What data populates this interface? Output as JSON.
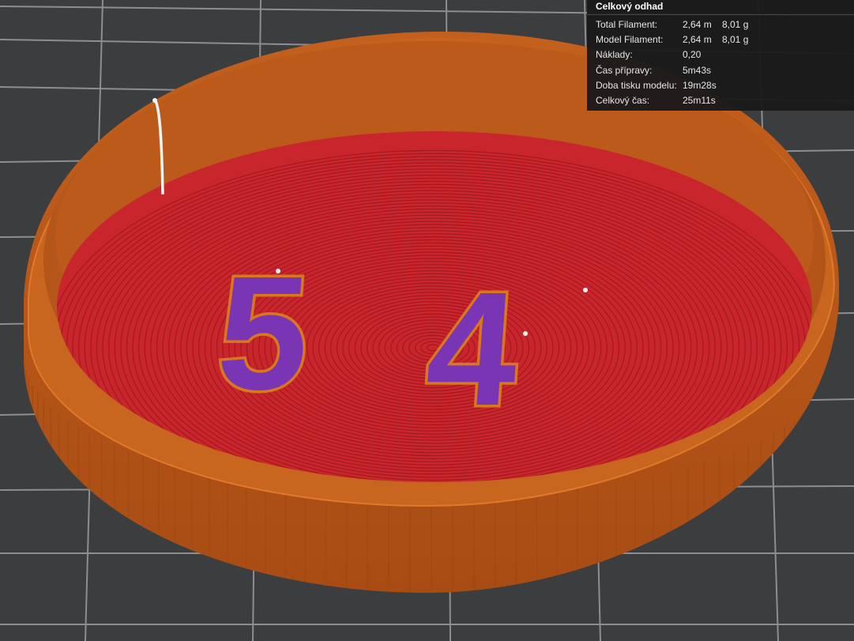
{
  "viewport": {
    "bed_color": "#3c3d3f",
    "grid_color": "#8d8e90",
    "wall_color": "#c45e1c",
    "floor_color": "#c8262c",
    "text_fill_color": "#7a35b4",
    "seam_color": "#f2f2f2",
    "model_text": [
      "5",
      "4"
    ]
  },
  "stats": {
    "title": "Celkový odhad",
    "rows": [
      {
        "label": "Total Filament:",
        "v1": "2,64 m",
        "v2": "8,01 g"
      },
      {
        "label": "Model Filament:",
        "v1": "2,64 m",
        "v2": "8,01 g"
      },
      {
        "label": "Náklady:",
        "v1": "0,20",
        "v2": ""
      },
      {
        "label": "Čas přípravy:",
        "v1": "5m43s",
        "v2": ""
      },
      {
        "label": "Doba tisku modelu:",
        "v1": "19m28s",
        "v2": ""
      },
      {
        "label": "Celkový čas:",
        "v1": "25m11s",
        "v2": ""
      }
    ]
  }
}
